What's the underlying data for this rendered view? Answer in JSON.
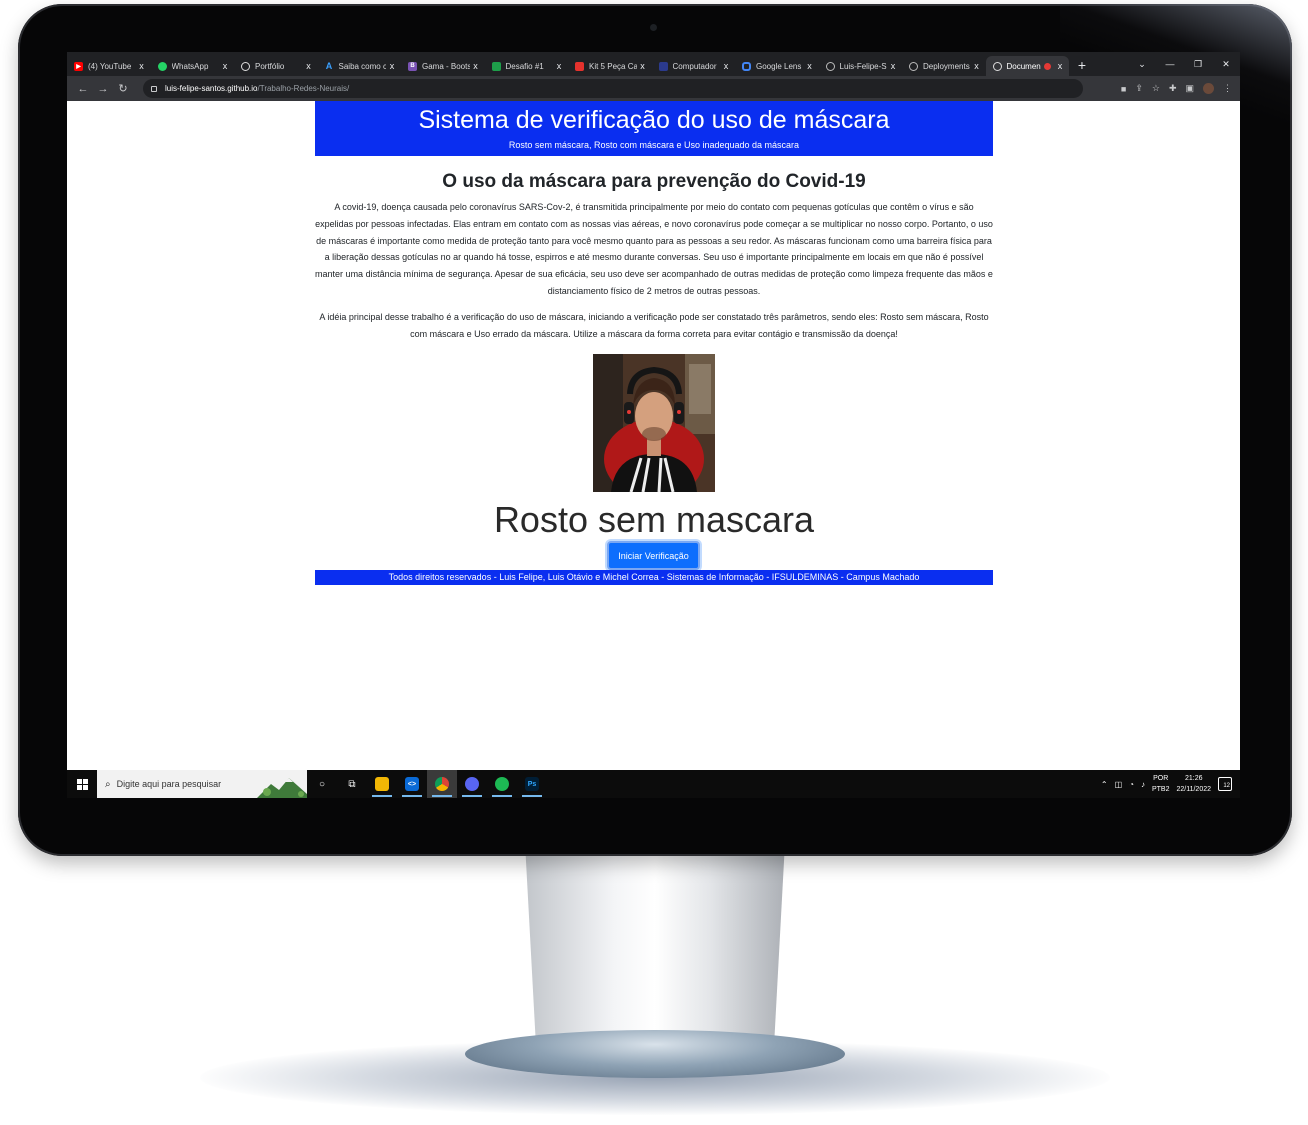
{
  "browser": {
    "tabs": [
      {
        "title": "(4) YouTube",
        "icon": "youtube-icon",
        "color": "#ff0000"
      },
      {
        "title": "WhatsApp",
        "icon": "whatsapp-icon",
        "color": "#25d366"
      },
      {
        "title": "Portfólio",
        "icon": "globe-icon",
        "color": "#dddddd"
      },
      {
        "title": "Saiba como c",
        "icon": "arc-icon",
        "color": "#3aa0ff"
      },
      {
        "title": "Gama - Boots",
        "icon": "bootstrap-icon",
        "color": "#7952b3"
      },
      {
        "title": "Desafio #1",
        "icon": "desafio-icon",
        "color": "#1e9e4a"
      },
      {
        "title": "Kit 5 Peça Ca",
        "icon": "shop-icon",
        "color": "#e5322d"
      },
      {
        "title": "Computador",
        "icon": "store-icon",
        "color": "#2b3a8c"
      },
      {
        "title": "Google Lens",
        "icon": "google-lens-icon",
        "color": "#4285f4"
      },
      {
        "title": "Luis-Felipe-S",
        "icon": "github-icon",
        "color": "#bbbbbb"
      },
      {
        "title": "Deployments",
        "icon": "github-icon",
        "color": "#bbbbbb"
      },
      {
        "title": "Documen",
        "icon": "globe-icon",
        "color": "#dddddd",
        "active": true
      }
    ],
    "close_glyph": "x",
    "new_tab_glyph": "+",
    "url_host": "luis-felipe-santos.github.io",
    "url_path": "/Trabalho-Redes-Neurais/"
  },
  "page": {
    "title": "Sistema de verificação do uso de máscara",
    "subtitle": "Rosto sem máscara, Rosto com máscara e Uso inadequado da máscara",
    "section_title": "O uso da máscara para prevenção do Covid-19",
    "paragraph1": "A covid-19, doença causada pelo coronavírus SARS-Cov-2, é transmitida principalmente por meio do contato com pequenas gotículas que contêm o vírus e são expelidas por pessoas infectadas. Elas entram em contato com as nossas vias aéreas, e novo coronavírus pode começar a se multiplicar no nosso corpo. Portanto, o uso de máscaras é importante como medida de proteção tanto para você mesmo quanto para as pessoas a seu redor. As máscaras funcionam como uma barreira física para a liberação dessas gotículas no ar quando há tosse, espirros e até mesmo durante conversas. Seu uso é importante principalmente em locais em que não é possível manter uma distância mínima de segurança. Apesar de sua eficácia, seu uso deve ser acompanhado de outras medidas de proteção como limpeza frequente das mãos e distanciamento físico de 2 metros de outras pessoas.",
    "paragraph2": "A idéia principal desse trabalho é a verificação do uso de máscara, iniciando a verificação pode ser constatado três parâmetros, sendo eles: Rosto sem máscara, Rosto com máscara e Uso errado da máscara. Utilize a máscara da forma correta para evitar contágio e transmissão da doença!",
    "result_label": "Rosto sem mascara",
    "button_label": "Iniciar Verificação",
    "footer": "Todos direitos reservados - Luis Felipe, Luis Otávio e Michel Correa - Sistemas de Informação - IFSULDEMINAS - Campus Machado"
  },
  "taskbar": {
    "search_placeholder": "Digite aqui para pesquisar",
    "language": "POR",
    "keyboard": "PTB2",
    "time": "21:26",
    "date": "22/11/2022",
    "notification_count": "12"
  },
  "colors": {
    "header_blue": "#0a2ef0",
    "button_blue": "#0d6efd"
  }
}
